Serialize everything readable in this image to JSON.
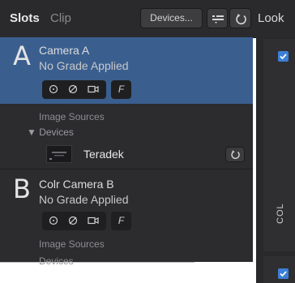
{
  "header": {
    "tabs": [
      {
        "label": "Slots",
        "active": true
      },
      {
        "label": "Clip",
        "active": false
      }
    ],
    "devices_button": "Devices...",
    "list_icon": "list-menu-icon",
    "refresh_icon": "refresh-icon",
    "right_tab": "Look"
  },
  "slots": [
    {
      "letter": "A",
      "camera": "Camera A",
      "grade": "No Grade Applied",
      "selected": true,
      "f_label": "F",
      "image_sources_label": "Image Sources",
      "devices_label": "▼ Devices",
      "devices": [
        {
          "name": "Teradek"
        }
      ]
    },
    {
      "letter": "B",
      "camera": "Colr Camera B",
      "grade": "No Grade Applied",
      "selected": false,
      "f_label": "F",
      "image_sources_label": "Image Sources",
      "devices_label": "Devices"
    }
  ],
  "right_panel": {
    "col_label": "COL",
    "checkbox_1_checked": true,
    "checkbox_2_checked": true
  },
  "colors": {
    "selected_slot": "#3a5f8f",
    "panel_bg": "#2c2c2e",
    "checkbox_blue": "#3b7fd6"
  }
}
